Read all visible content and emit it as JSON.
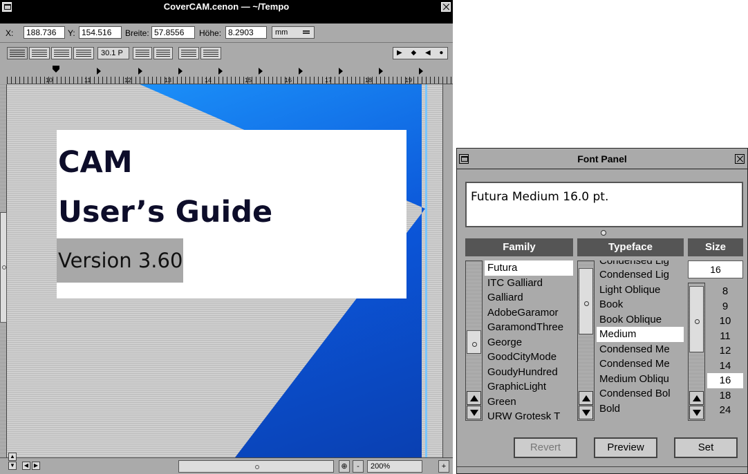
{
  "doc_window": {
    "title": "CoverCAM.cenon — ~/Tempo",
    "coords": {
      "x_label": "X:",
      "x_value": "188.736",
      "y_label": "Y:",
      "y_value": "154.516",
      "width_label": "Breite:",
      "width_value": "57.8556",
      "height_label": "Höhe:",
      "height_value": "8.2903",
      "unit": "mm"
    },
    "format_bar": {
      "line_spacing": "30.1 P",
      "tab_controls": "▶ ◆ ◀ ●"
    },
    "ruler": {
      "numbers": [
        "10",
        "11",
        "12",
        "13",
        "14",
        "15",
        "16",
        "17",
        "18",
        "19"
      ]
    },
    "canvas": {
      "heading_1": "CAM",
      "heading_2": "User’s Guide",
      "version": "Version 3.60"
    },
    "statusbar": {
      "zoom": "200%"
    }
  },
  "font_panel": {
    "title": "Font Panel",
    "preview_text": "Futura Medium 16.0 pt.",
    "columns": {
      "family": "Family",
      "typeface": "Typeface",
      "size": "Size"
    },
    "families": [
      "Futura",
      "ITC Galliard",
      "Galliard",
      "AdobeGaramor",
      "GaramondThree",
      "George",
      "GoodCityMode",
      "GoudyHundred",
      "GraphicLight",
      "Green",
      "URW Grotesk T"
    ],
    "selected_family": "Futura",
    "typefaces": [
      "Condensed Lig",
      "Condensed Lig",
      "Light Oblique",
      "Book",
      "Book Oblique",
      "Medium",
      "Condensed Me",
      "Condensed Me",
      "Medium Obliqu",
      "Condensed Bol",
      "Bold"
    ],
    "selected_typeface": "Medium",
    "size_value": "16",
    "sizes": [
      "8",
      "9",
      "10",
      "11",
      "12",
      "14",
      "16",
      "18",
      "24"
    ],
    "selected_size": "16",
    "buttons": {
      "revert": "Revert",
      "preview": "Preview",
      "set": "Set"
    }
  }
}
